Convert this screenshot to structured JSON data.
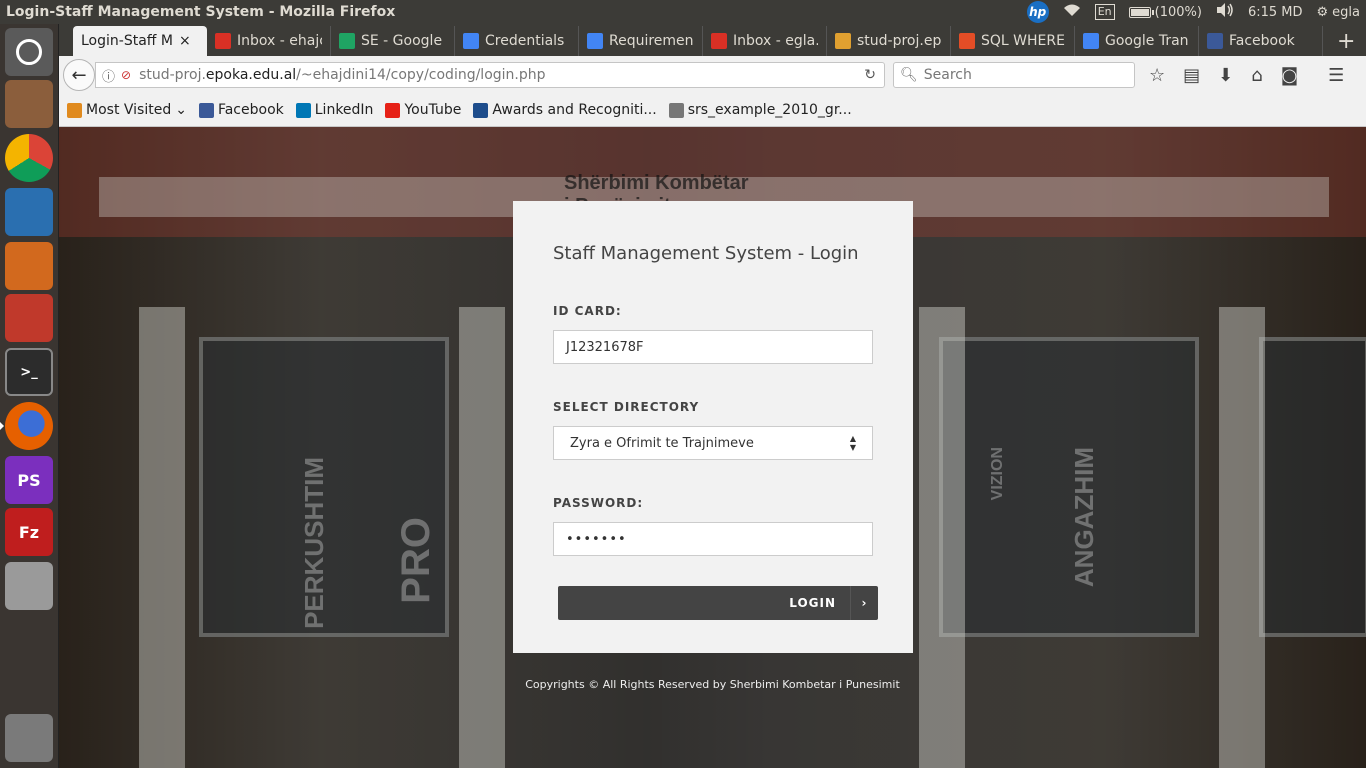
{
  "top_panel": {
    "window_title": "Login-Staff Management System - Mozilla Firefox",
    "keyboard": "En",
    "battery": "(100%)",
    "battery_level": 1.0,
    "time": "6:15 MD",
    "user": "egla"
  },
  "launcher": {
    "items": [
      {
        "name": "ubuntu-dash-icon",
        "color": "#6e6e6e"
      },
      {
        "name": "files-icon",
        "color": "#8b5e3c"
      },
      {
        "name": "chrome-icon",
        "color": "#db4437"
      },
      {
        "name": "libreoffice-writer-icon",
        "color": "#2a6fb0"
      },
      {
        "name": "libreoffice-impress-icon",
        "color": "#d2691e"
      },
      {
        "name": "system-settings-icon",
        "color": "#c0392b"
      },
      {
        "name": "terminal-icon",
        "color": "#2c2c2c"
      },
      {
        "name": "firefox-icon",
        "color": "#e66000"
      },
      {
        "name": "phpstorm-icon",
        "color": "#7b2fbe"
      },
      {
        "name": "filezilla-icon",
        "color": "#bf1e1e"
      },
      {
        "name": "disk-icon",
        "color": "#9a9a9a"
      },
      {
        "name": "trash-icon",
        "color": "#7a7a7a"
      }
    ],
    "labels": {
      "phpstorm": "PS",
      "filezilla": "Fz"
    }
  },
  "tabs": [
    {
      "label": "Login-Staff M",
      "favicon": "#3c3b37",
      "active": true
    },
    {
      "label": "Inbox - ehajc",
      "favicon": "#d93025"
    },
    {
      "label": "SE - Google D",
      "favicon": "#1fa463"
    },
    {
      "label": "Credentials",
      "favicon": "#4285f4"
    },
    {
      "label": "Requiremen",
      "favicon": "#4285f4"
    },
    {
      "label": "Inbox - egla.",
      "favicon": "#d93025"
    },
    {
      "label": "stud-proj.ep",
      "favicon": "#e0a030"
    },
    {
      "label": "SQL WHERE",
      "favicon": "#e44d26"
    },
    {
      "label": "Google Tran",
      "favicon": "#4285f4"
    },
    {
      "label": "Facebook",
      "favicon": "#3b5998"
    }
  ],
  "navbar": {
    "url_prefix": "stud-proj.",
    "url_domain": "epoka.edu.al",
    "url_path": "/~ehajdini14/copy/coding/login.php",
    "search_placeholder": "Search"
  },
  "bookmarks": [
    {
      "label": "Most Visited",
      "favicon": "#e08a1e",
      "has_arrow": true
    },
    {
      "label": "Facebook",
      "favicon": "#3b5998"
    },
    {
      "label": "LinkedIn",
      "favicon": "#0077b5"
    },
    {
      "label": "YouTube",
      "favicon": "#e62117"
    },
    {
      "label": "Awards and Recogniti...",
      "favicon": "#1e4d8c"
    },
    {
      "label": "srs_example_2010_gr...",
      "favicon": "#777777"
    }
  ],
  "background": {
    "sign": "Shërbimi Kombëtar",
    "sign_line2": "i Punësimit",
    "vertical_words": [
      "PERKUSHTIM",
      "PRO",
      "VIZION",
      "ANGAZHIM"
    ]
  },
  "login": {
    "title": "Staff Management System - Login",
    "id_label": "ID CARD:",
    "id_value": "J12321678F",
    "directory_label": "SELECT DIRECTORY",
    "directory_value": "Zyra e Ofrimit te Trajnimeve",
    "password_label": "PASSWORD:",
    "password_value": "•••••••",
    "button_label": "LOGIN"
  },
  "footer": "Copyrights © All Rights Reserved by Sherbimi Kombetar i Punesimit"
}
